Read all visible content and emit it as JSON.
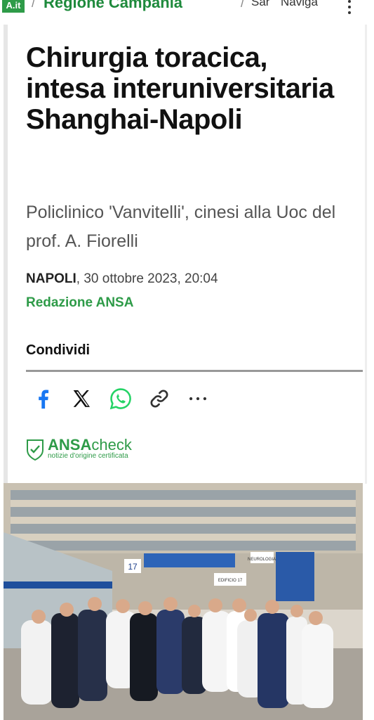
{
  "breadcrumb": {
    "logo": "A.it",
    "region": "Regione Campania",
    "section_short": "Sar",
    "navigate": "Naviga"
  },
  "article": {
    "title": "Chirurgia toracica, intesa interuniversitaria Shanghai-Napoli",
    "subtitle": "Policlinico 'Vanvitelli', cinesi alla Uoc del prof. A. Fiorelli",
    "location": "NAPOLI",
    "date": ", 30 ottobre 2023, 20:04",
    "author": "Redazione ANSA"
  },
  "share": {
    "label": "Condividi",
    "icons": [
      "facebook-icon",
      "x-icon",
      "whatsapp-icon",
      "link-icon",
      "more-icon"
    ]
  },
  "ansacheck": {
    "brand": "ANSA",
    "suffix": "check",
    "tagline": "notizie d'origine certificata"
  },
  "photo": {
    "signs": [
      "17",
      "NEUROLOGIA",
      "EDIFICIO 17"
    ]
  },
  "colors": {
    "brand_green": "#2e9b48",
    "facebook": "#1877f2",
    "whatsapp": "#25d366"
  }
}
